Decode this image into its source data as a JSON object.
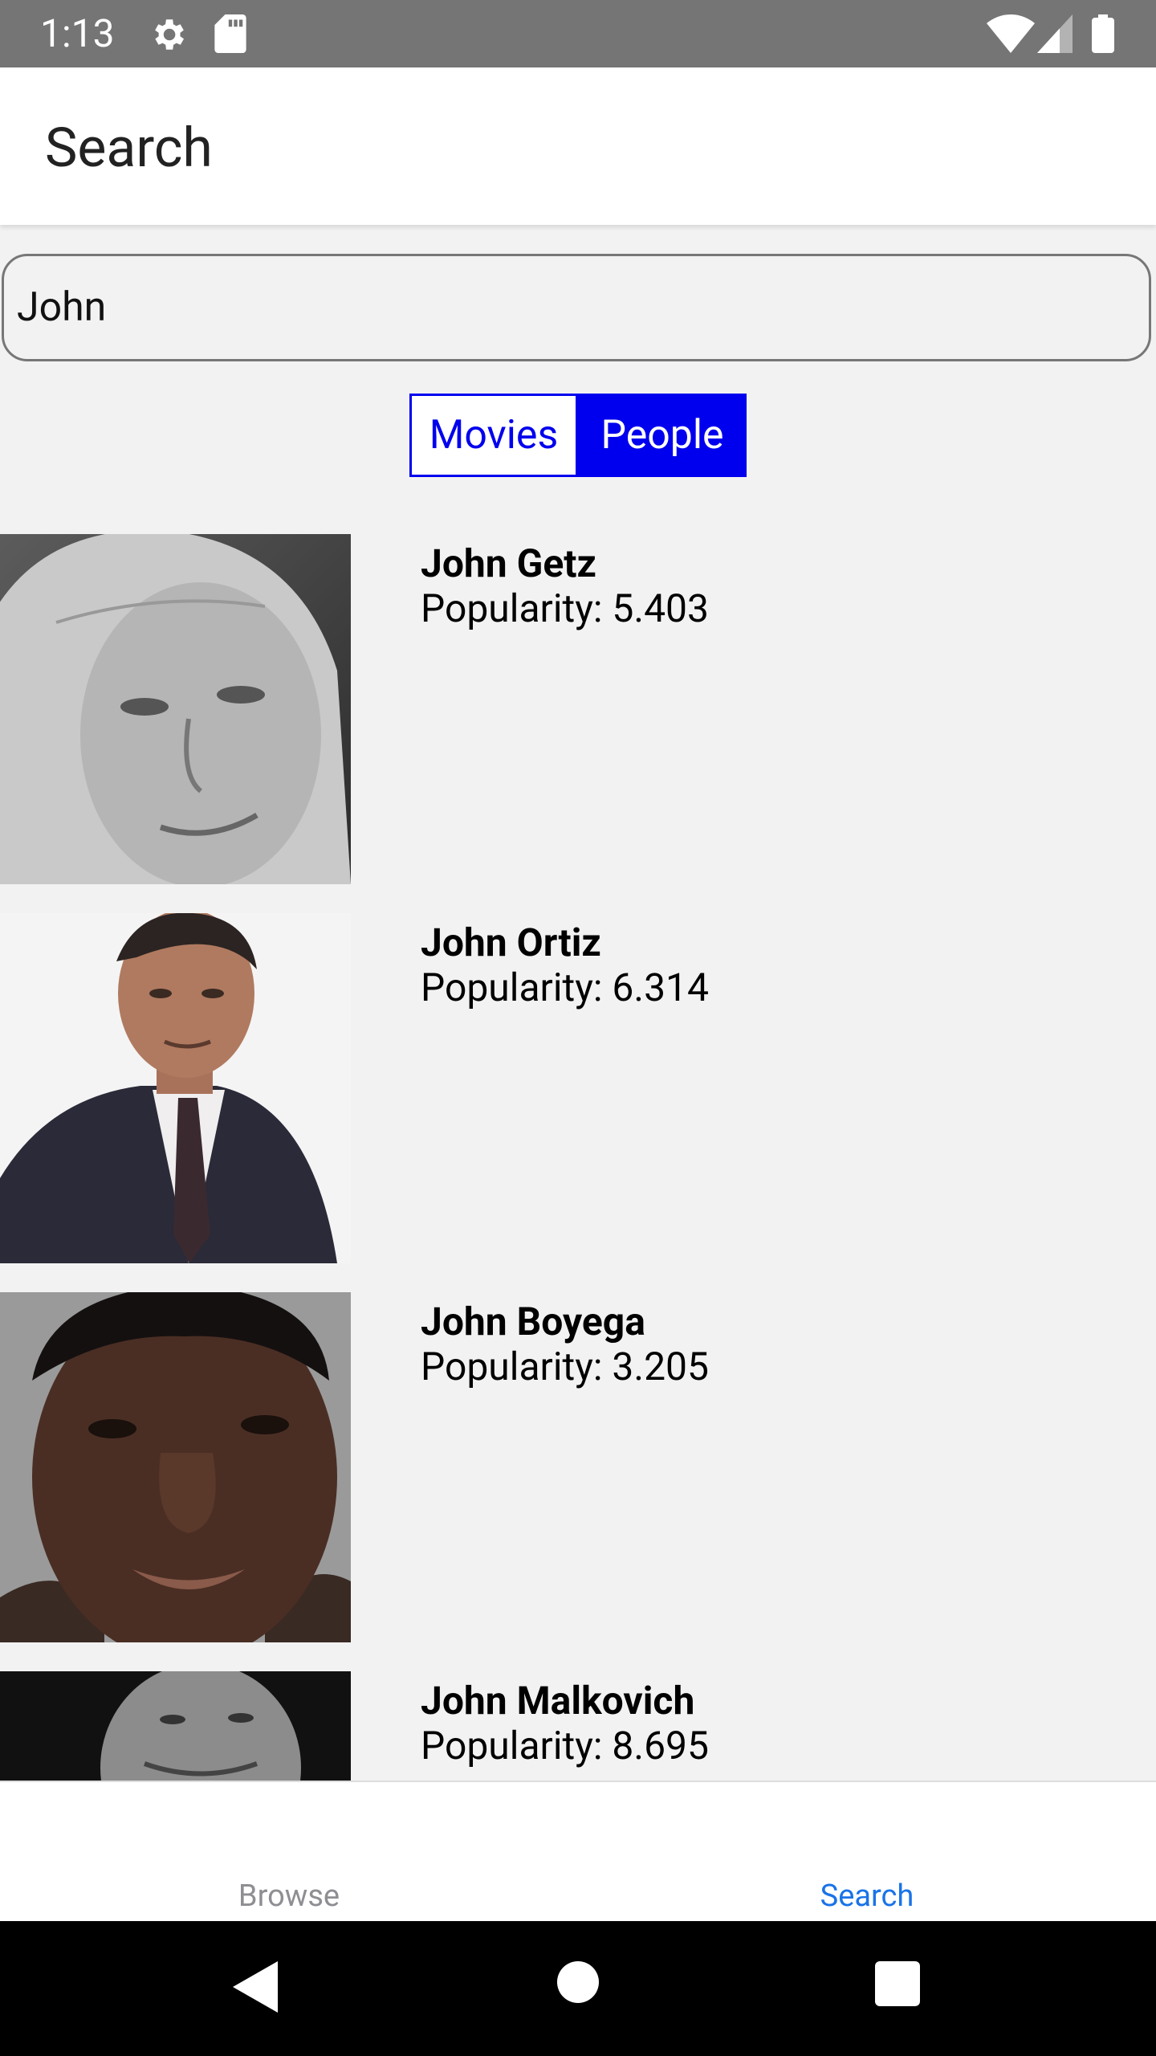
{
  "status_bar": {
    "time": "1:13",
    "icons": [
      "gear-icon",
      "sd-card-icon",
      "wifi-icon",
      "signal-icon",
      "battery-icon"
    ]
  },
  "header": {
    "title": "Search"
  },
  "search": {
    "value": "John"
  },
  "toggle": {
    "movies_label": "Movies",
    "people_label": "People",
    "selected": "People",
    "accent": "#0000ee"
  },
  "results": [
    {
      "name": "John Getz",
      "popularity": "Popularity: 5.403"
    },
    {
      "name": "John Ortiz",
      "popularity": "Popularity: 6.314"
    },
    {
      "name": "John Boyega",
      "popularity": "Popularity: 3.205"
    },
    {
      "name": "John Malkovich",
      "popularity": "Popularity: 8.695"
    }
  ],
  "bottom_nav": {
    "browse_label": "Browse",
    "search_label": "Search",
    "active": "Search",
    "active_color": "#1a73e8"
  },
  "system_nav": {
    "icons": [
      "back-icon",
      "home-icon",
      "recents-icon"
    ]
  }
}
